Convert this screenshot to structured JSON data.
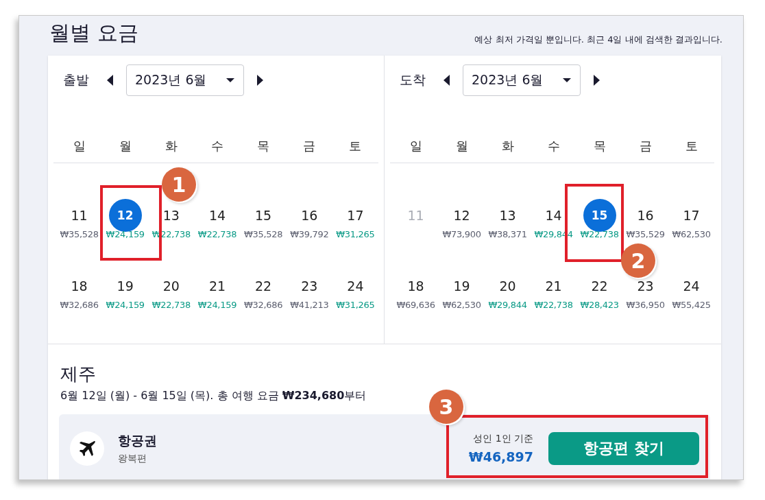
{
  "header": {
    "title": "월별 요금",
    "note": "예상 최저 가격일 뿐입니다. 최근 4일 내에 검색한 결과입니다."
  },
  "calendars": [
    {
      "label": "출발",
      "month": "2023년 6월",
      "weekdays": [
        "일",
        "월",
        "화",
        "수",
        "목",
        "금",
        "토"
      ],
      "weeks": [
        [
          {
            "day": "11",
            "price": "₩35,528",
            "low": false,
            "selected": false,
            "disabled": false
          },
          {
            "day": "12",
            "price": "₩24,159",
            "low": true,
            "selected": true,
            "disabled": false
          },
          {
            "day": "13",
            "price": "₩22,738",
            "low": true,
            "selected": false,
            "disabled": false
          },
          {
            "day": "14",
            "price": "₩22,738",
            "low": true,
            "selected": false,
            "disabled": false
          },
          {
            "day": "15",
            "price": "₩35,528",
            "low": false,
            "selected": false,
            "disabled": false
          },
          {
            "day": "16",
            "price": "₩39,792",
            "low": false,
            "selected": false,
            "disabled": false
          },
          {
            "day": "17",
            "price": "₩31,265",
            "low": true,
            "selected": false,
            "disabled": false
          }
        ],
        [
          {
            "day": "18",
            "price": "₩32,686",
            "low": false,
            "selected": false,
            "disabled": false
          },
          {
            "day": "19",
            "price": "₩24,159",
            "low": true,
            "selected": false,
            "disabled": false
          },
          {
            "day": "20",
            "price": "₩22,738",
            "low": true,
            "selected": false,
            "disabled": false
          },
          {
            "day": "21",
            "price": "₩24,159",
            "low": true,
            "selected": false,
            "disabled": false
          },
          {
            "day": "22",
            "price": "₩32,686",
            "low": false,
            "selected": false,
            "disabled": false
          },
          {
            "day": "23",
            "price": "₩41,213",
            "low": false,
            "selected": false,
            "disabled": false
          },
          {
            "day": "24",
            "price": "₩31,265",
            "low": true,
            "selected": false,
            "disabled": false
          }
        ]
      ]
    },
    {
      "label": "도착",
      "month": "2023년 6월",
      "weekdays": [
        "일",
        "월",
        "화",
        "수",
        "목",
        "금",
        "토"
      ],
      "weeks": [
        [
          {
            "day": "11",
            "selected": false,
            "disabled": true
          },
          {
            "day": "12",
            "price": "₩73,900",
            "low": false,
            "selected": false,
            "disabled": false
          },
          {
            "day": "13",
            "price": "₩38,371",
            "low": false,
            "selected": false,
            "disabled": false
          },
          {
            "day": "14",
            "price": "₩29,844",
            "low": true,
            "selected": false,
            "disabled": false
          },
          {
            "day": "15",
            "price": "₩22,738",
            "low": true,
            "selected": true,
            "disabled": false
          },
          {
            "day": "16",
            "price": "₩35,529",
            "low": false,
            "selected": false,
            "disabled": false
          },
          {
            "day": "17",
            "price": "₩62,530",
            "low": false,
            "selected": false,
            "disabled": false
          }
        ],
        [
          {
            "day": "18",
            "price": "₩69,636",
            "low": false,
            "selected": false,
            "disabled": false
          },
          {
            "day": "19",
            "price": "₩62,530",
            "low": false,
            "selected": false,
            "disabled": false
          },
          {
            "day": "20",
            "price": "₩29,844",
            "low": true,
            "selected": false,
            "disabled": false
          },
          {
            "day": "21",
            "price": "₩22,738",
            "low": true,
            "selected": false,
            "disabled": false
          },
          {
            "day": "22",
            "price": "₩28,423",
            "low": true,
            "selected": false,
            "disabled": false
          },
          {
            "day": "23",
            "price": "₩36,950",
            "low": false,
            "selected": false,
            "disabled": false
          },
          {
            "day": "24",
            "price": "₩55,425",
            "low": false,
            "selected": false,
            "disabled": false
          }
        ]
      ]
    }
  ],
  "summary": {
    "destination": "제주",
    "dates": "6월 12일 (월) - 6월 15일 (목). 총 여행 요금 **₩234,680**부터"
  },
  "flight": {
    "title": "항공권",
    "subtitle": "왕복편",
    "basis": "성인 1인 기준",
    "price": "₩46,897",
    "button": "항공편 찾기"
  },
  "annotations": [
    "1",
    "2",
    "3"
  ]
}
